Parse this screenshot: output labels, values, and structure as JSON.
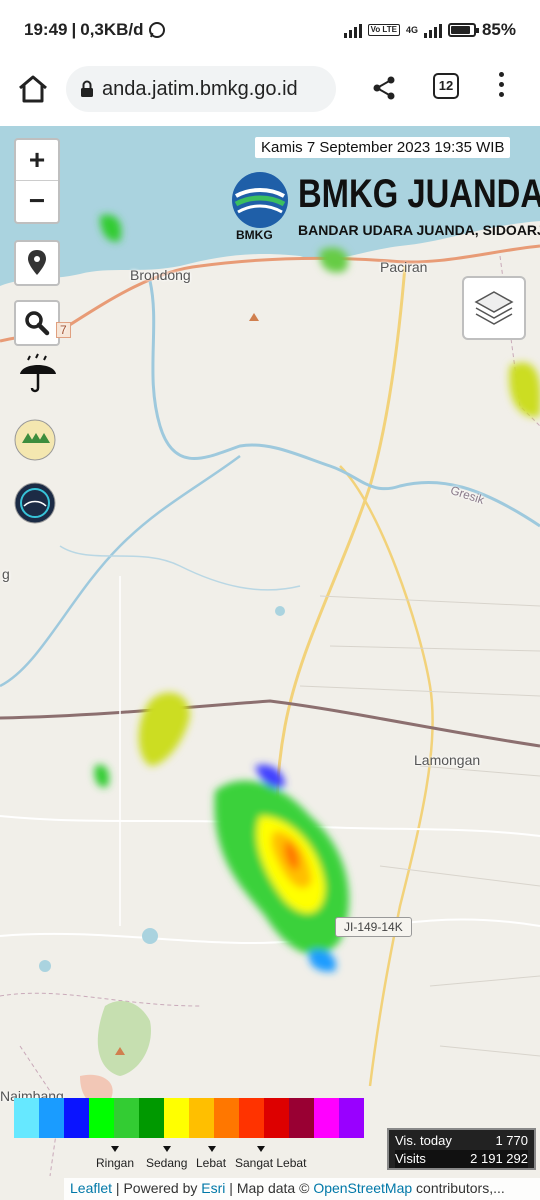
{
  "status_bar": {
    "time": "19:49",
    "network_speed": "0,3KB/d",
    "battery": "85%",
    "volte": "Vo LTE",
    "net_type": "4G"
  },
  "browser": {
    "url": "anda.jatim.bmkg.go.id",
    "tab_count": "12"
  },
  "map": {
    "zoom_in": "+",
    "zoom_out": "−",
    "datetime": "Kamis 7 September 2023 19:35 WIB",
    "brand_title": "BMKG JUANDA",
    "brand_subtitle": "BANDAR UDARA JUANDA, SIDOARJO",
    "brand_logo_text": "BMKG",
    "places": {
      "brondong": "Brondong",
      "paciran": "Paciran",
      "gresik": "Gresik",
      "lamongan": "Lamongan",
      "naimbang": "Naimbang",
      "left_edge": "g"
    },
    "road_label": "JI-149-14K",
    "partial_label": "7"
  },
  "legend": {
    "colors": [
      "#66e8ff",
      "#1a9cff",
      "#0a14ff",
      "#00ff00",
      "#33cc33",
      "#009900",
      "#ffff00",
      "#ffbf00",
      "#ff7700",
      "#ff3300",
      "#dd0000",
      "#990033",
      "#ff00ff",
      "#9900ff"
    ],
    "labels": [
      "Ringan",
      "Sedang",
      "Lebat",
      "Sangat Lebat"
    ]
  },
  "visits": {
    "today_label": "Vis. today",
    "today_value": "1 770",
    "total_label": "Visits",
    "total_value": "2 191 292"
  },
  "attribution": {
    "leaflet": "Leaflet",
    "sep1": " | Powered by ",
    "esri": "Esri",
    "sep2": " | Map data © ",
    "osm": "OpenStreetMap",
    "tail": " contributors,..."
  }
}
